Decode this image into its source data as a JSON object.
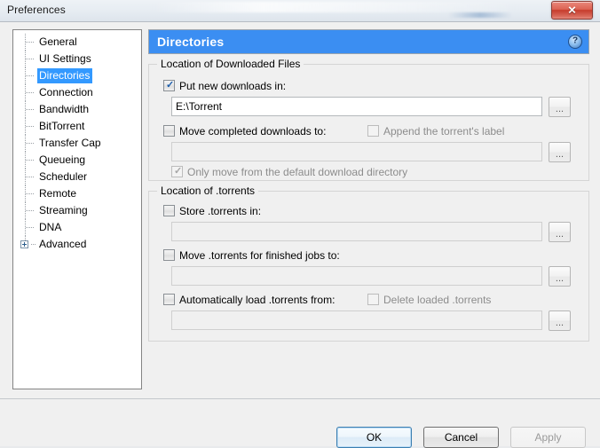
{
  "window": {
    "title": "Preferences",
    "close_label": "✕"
  },
  "sidebar": {
    "items": [
      {
        "label": "General",
        "selected": false,
        "expandable": false
      },
      {
        "label": "UI Settings",
        "selected": false,
        "expandable": false
      },
      {
        "label": "Directories",
        "selected": true,
        "expandable": false
      },
      {
        "label": "Connection",
        "selected": false,
        "expandable": false
      },
      {
        "label": "Bandwidth",
        "selected": false,
        "expandable": false
      },
      {
        "label": "BitTorrent",
        "selected": false,
        "expandable": false
      },
      {
        "label": "Transfer Cap",
        "selected": false,
        "expandable": false
      },
      {
        "label": "Queueing",
        "selected": false,
        "expandable": false
      },
      {
        "label": "Scheduler",
        "selected": false,
        "expandable": false
      },
      {
        "label": "Remote",
        "selected": false,
        "expandable": false
      },
      {
        "label": "Streaming",
        "selected": false,
        "expandable": false
      },
      {
        "label": "DNA",
        "selected": false,
        "expandable": false
      },
      {
        "label": "Advanced",
        "selected": false,
        "expandable": true
      }
    ]
  },
  "pane": {
    "title": "Directories",
    "help_icon_label": "?",
    "group_downloads": {
      "title": "Location of Downloaded Files",
      "put_new_downloads": {
        "label": "Put new downloads in:",
        "checked": true,
        "enabled": true,
        "value": "E:\\Torrent",
        "browse_label": "..."
      },
      "move_completed": {
        "label": "Move completed downloads to:",
        "checked": false,
        "enabled": true,
        "value": "",
        "browse_label": "..."
      },
      "append_label": {
        "label": "Append the torrent's label",
        "checked": false,
        "enabled": false
      },
      "only_move_default": {
        "label": "Only move from the default download directory",
        "checked": true,
        "enabled": false
      }
    },
    "group_torrents": {
      "title": "Location of .torrents",
      "store_torrents": {
        "label": "Store .torrents in:",
        "checked": false,
        "enabled": true,
        "value": "",
        "browse_label": "..."
      },
      "move_finished": {
        "label": "Move .torrents for finished jobs to:",
        "checked": false,
        "enabled": true,
        "value": "",
        "browse_label": "..."
      },
      "auto_load": {
        "label": "Automatically load .torrents from:",
        "checked": false,
        "enabled": true,
        "value": "",
        "browse_label": "..."
      },
      "delete_loaded": {
        "label": "Delete loaded .torrents",
        "checked": false,
        "enabled": false
      }
    }
  },
  "footer": {
    "ok_label": "OK",
    "cancel_label": "Cancel",
    "apply_label": "Apply"
  },
  "colors": {
    "header_blue": "#3b8ef2",
    "selection_blue": "#3399ff",
    "dialog_bg": "#f0f0f0",
    "close_red": "#c63c2c"
  }
}
